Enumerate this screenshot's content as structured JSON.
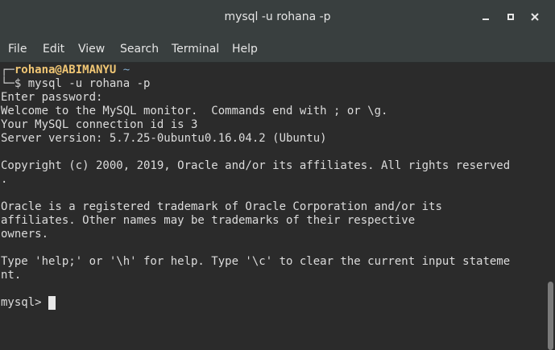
{
  "window": {
    "title": "mysql -u rohana -p"
  },
  "menubar": {
    "items": [
      "File",
      "Edit",
      "View",
      "Search",
      "Terminal",
      "Help"
    ]
  },
  "terminal": {
    "prompt_corner_top": "┌─",
    "prompt_user": "rohana@ABIMANYU",
    "prompt_dir": "~",
    "prompt_corner_bottom": "└─",
    "prompt_symbol": "$",
    "command": "mysql -u rohana -p",
    "lines": [
      "Enter password:",
      "Welcome to the MySQL monitor.  Commands end with ; or \\g.",
      "Your MySQL connection id is 3",
      "Server version: 5.7.25-0ubuntu0.16.04.2 (Ubuntu)",
      "",
      "Copyright (c) 2000, 2019, Oracle and/or its affiliates. All rights reserved",
      ".",
      "",
      "Oracle is a registered trademark of Oracle Corporation and/or its",
      "affiliates. Other names may be trademarks of their respective",
      "owners.",
      "",
      "Type 'help;' or '\\h' for help. Type '\\c' to clear the current input stateme",
      "nt.",
      ""
    ],
    "mysql_prompt": "mysql> "
  }
}
